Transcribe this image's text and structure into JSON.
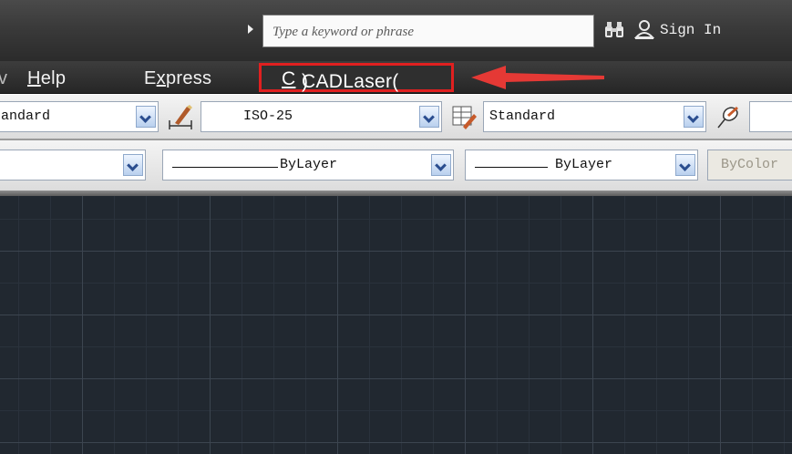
{
  "search": {
    "placeholder": "Type a keyword or phrase"
  },
  "header": {
    "signin_label": "Sign In"
  },
  "menu": {
    "edge_fragment": "v",
    "help": {
      "first": "H",
      "rest": "elp"
    },
    "express": {
      "first": "E",
      "underlined": "x",
      "rest": "press"
    },
    "cadlaser": {
      "label": "CADLaser(",
      "underlined": "C",
      "close": ")"
    }
  },
  "toolbar1": {
    "text_style": "andard",
    "dim_style": "ISO-25",
    "table_style": "Standard"
  },
  "toolbar2": {
    "linetype": "ByLayer",
    "lineweight": "ByLayer",
    "plot_style": "ByColor"
  },
  "colors": {
    "highlight": "#e02020",
    "canvas_bg": "#212830"
  }
}
